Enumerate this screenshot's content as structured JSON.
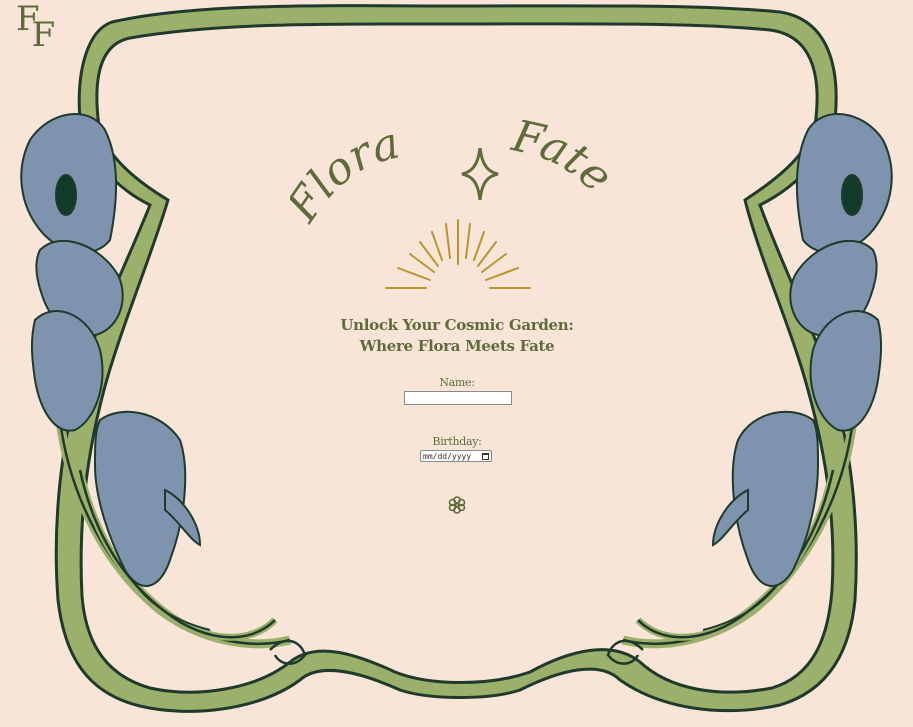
{
  "brand": {
    "monogram_1": "F",
    "monogram_2": "F"
  },
  "header": {
    "title_left": "Flora",
    "title_right": "Fate"
  },
  "tagline": {
    "line1": "Unlock Your Cosmic Garden:",
    "line2": "Where Flora Meets Fate"
  },
  "form": {
    "name_label": "Name:",
    "name_value": "",
    "birthday_label": "Birthday:",
    "birthday_placeholder": "mm/dd/yyyy"
  },
  "icons": {
    "star": "four-point-star-icon",
    "sunburst": "sunburst-icon",
    "submit": "flower-icon",
    "calendar": "calendar-icon"
  },
  "colors": {
    "background": "#f9e5d8",
    "frame_green": "#9bb06a",
    "outline": "#1f3a2c",
    "flower_blue": "#7e93ae",
    "text_olive": "#5f6b3a",
    "gold": "#b9962c"
  }
}
